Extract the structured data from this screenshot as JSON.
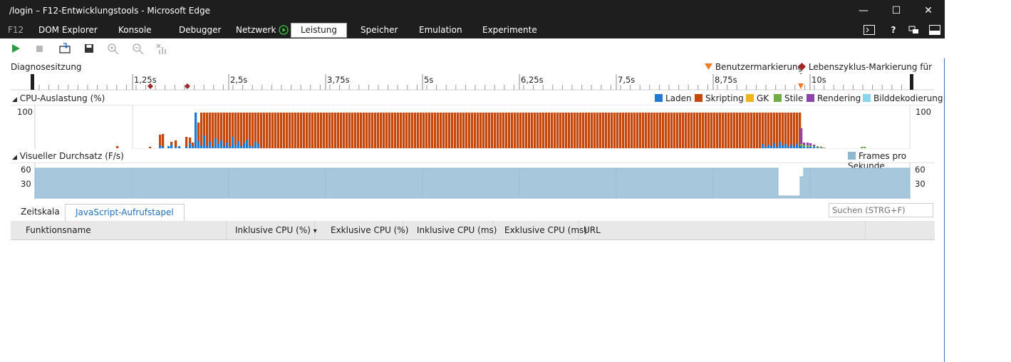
{
  "window": {
    "title": "/login – F12-Entwicklungstools - Microsoft Edge",
    "minimize": "—",
    "maximize": "☐",
    "close": "✕"
  },
  "tabs": {
    "f12": "F12",
    "items": [
      "DOM Explorer",
      "Konsole",
      "Debugger",
      "Netzwerk",
      "Leistung",
      "Speicher",
      "Emulation",
      "Experimente"
    ],
    "active": "Leistung"
  },
  "diag": {
    "title": "Diagnosesitzung",
    "legend_user": "Benutzermarkierung",
    "legend_lifecycle": "Lebenszyklus-Markierung für App",
    "ticks": [
      "1,25s",
      "2,5s",
      "3,75s",
      "5s",
      "6,25s",
      "7,5s",
      "8,75s",
      "10s"
    ]
  },
  "cpu": {
    "title": "CPU-Auslastung (%)",
    "ymax_left": "100",
    "ymax_right": "100",
    "legend": [
      {
        "label": "Laden",
        "color": "#1f7ad0"
      },
      {
        "label": "Skripting",
        "color": "#c4470b"
      },
      {
        "label": "GK",
        "color": "#f0b41c"
      },
      {
        "label": "Stile",
        "color": "#70ad47"
      },
      {
        "label": "Rendering",
        "color": "#8e44ad"
      },
      {
        "label": "Bilddekodierung",
        "color": "#8ad4ee"
      }
    ]
  },
  "fps": {
    "title": "Visueller Durchsatz (F/s)",
    "legend": "Frames pro Sekunde",
    "legend_color": "#8fb8cf",
    "y_left": [
      "60",
      "30"
    ],
    "y_right": [
      "60",
      "30"
    ]
  },
  "bottom_tabs": {
    "timeline": "Zeitskala",
    "callstack": "JavaScript-Aufrufstapel"
  },
  "search": {
    "placeholder": "Suchen (STRG+F)"
  },
  "table": {
    "columns": [
      "Funktionsname",
      "Inklusive CPU (%)",
      "Exklusive CPU (%)",
      "Inklusive CPU (ms)",
      "Exklusive CPU (ms)",
      "URL"
    ],
    "sort_arrow": "▾"
  }
}
